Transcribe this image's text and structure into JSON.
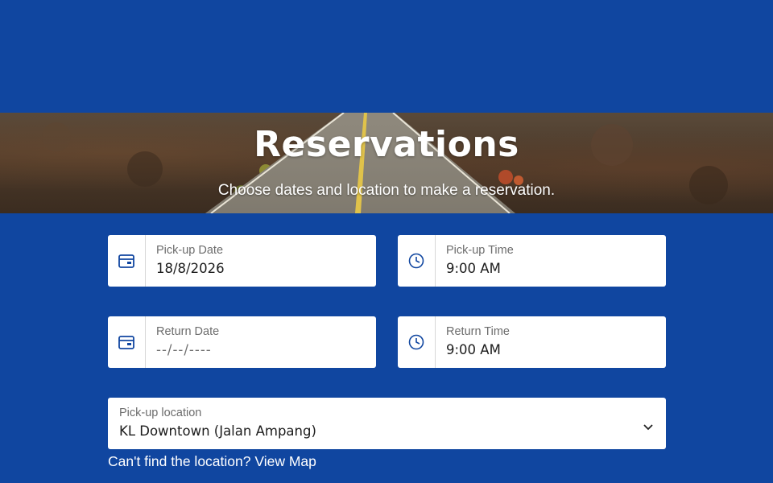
{
  "hero": {
    "title": "Reservations",
    "subtitle": "Choose dates and location to make a reservation."
  },
  "form": {
    "pickup_date": {
      "label": "Pick-up Date",
      "value": "18/8/2026",
      "icon": "calendar-icon"
    },
    "pickup_time": {
      "label": "Pick-up Time",
      "value": "9:00 AM",
      "icon": "clock-icon"
    },
    "return_date": {
      "label": "Return Date",
      "placeholder": "--/--/----",
      "icon": "calendar-icon"
    },
    "return_time": {
      "label": "Return Time",
      "value": "9:00 AM",
      "icon": "clock-icon"
    },
    "pickup_location": {
      "label": "Pick-up location",
      "value": "KL Downtown (Jalan Ampang)",
      "icon": "chevron-down-icon"
    }
  },
  "map_prompt": {
    "text": "Can't find the location?",
    "link": "View Map"
  },
  "colors": {
    "background": "#1046a0",
    "field_bg": "#ffffff",
    "icon": "#1046a0"
  }
}
